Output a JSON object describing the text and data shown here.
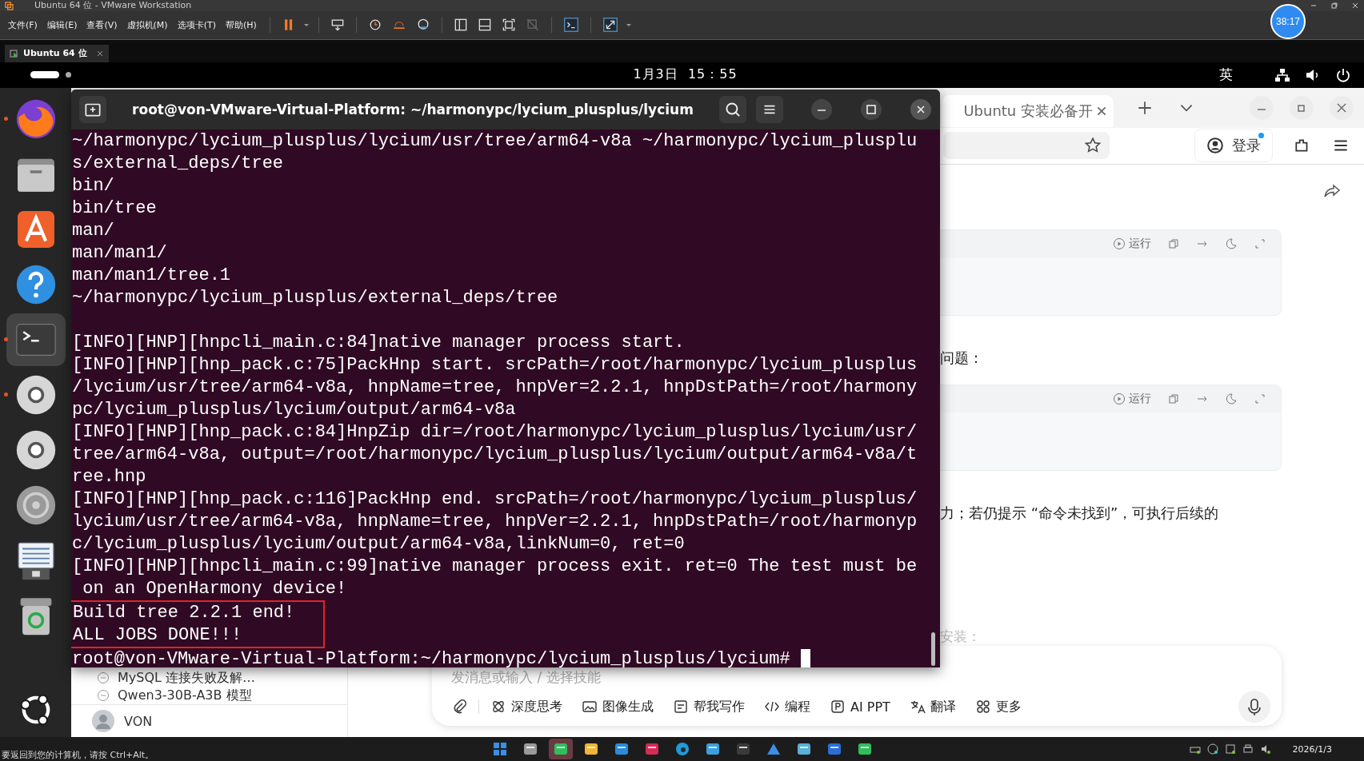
{
  "vmware": {
    "title": "Ubuntu 64 位 - VMware Workstation",
    "menu": [
      "文件(F)",
      "编辑(E)",
      "查看(V)",
      "虚拟机(M)",
      "选项卡(T)",
      "帮助(H)"
    ],
    "tabs": [
      {
        "label": "Ubuntu 64 位",
        "selected": true
      }
    ],
    "timer": "38:17",
    "status": "要返回到您的计算机，请按 Ctrl+Alt。"
  },
  "top_bar": {
    "date": "1月3日",
    "time": "15：55",
    "input_method": "英"
  },
  "dock": [
    {
      "kind": "firefox",
      "running": true,
      "selected": false
    },
    {
      "kind": "files",
      "running": false,
      "selected": false
    },
    {
      "kind": "store",
      "running": false,
      "selected": false
    },
    {
      "kind": "help",
      "running": false,
      "selected": false
    },
    {
      "kind": "terminal",
      "running": true,
      "selected": true
    },
    {
      "kind": "disc",
      "running": true,
      "selected": false
    },
    {
      "kind": "disc",
      "running": false,
      "selected": false
    },
    {
      "kind": "drive",
      "running": false,
      "selected": false
    },
    {
      "kind": "document",
      "running": false,
      "selected": false
    },
    {
      "kind": "trash",
      "running": false,
      "selected": false
    }
  ],
  "terminal": {
    "title": "root@von-VMware-Virtual-Platform: ~/harmonypc/lycium_plusplus/lycium",
    "lines": [
      {
        "kind": "text",
        "text": "~/harmonypc/lycium_plusplus/lycium/usr/tree/arm64-v8a ~/harmonypc/lycium_plusplu"
      },
      {
        "kind": "text",
        "text": "s/external_deps/tree"
      },
      {
        "kind": "text",
        "text": "bin/"
      },
      {
        "kind": "text",
        "text": "bin/tree"
      },
      {
        "kind": "text",
        "text": "man/"
      },
      {
        "kind": "text",
        "text": "man/man1/"
      },
      {
        "kind": "text",
        "text": "man/man1/tree.1"
      },
      {
        "kind": "text",
        "text": "~/harmonypc/lycium_plusplus/external_deps/tree"
      },
      {
        "kind": "blank"
      },
      {
        "kind": "text",
        "text": "[INFO][HNP][hnpcli_main.c:84]native manager process start."
      },
      {
        "kind": "text",
        "text": "[INFO][HNP][hnp_pack.c:75]PackHnp start. srcPath=/root/harmonypc/lycium_plusplus"
      },
      {
        "kind": "text",
        "text": "/lycium/usr/tree/arm64-v8a, hnpName=tree, hnpVer=2.2.1, hnpDstPath=/root/harmony"
      },
      {
        "kind": "text",
        "text": "pc/lycium_plusplus/lycium/output/arm64-v8a"
      },
      {
        "kind": "text",
        "text": "[INFO][HNP][hnp_pack.c:84]HnpZip dir=/root/harmonypc/lycium_plusplus/lycium/usr/"
      },
      {
        "kind": "text",
        "text": "tree/arm64-v8a, output=/root/harmonypc/lycium_plusplus/lycium/output/arm64-v8a/t"
      },
      {
        "kind": "text",
        "text": "ree.hnp"
      },
      {
        "kind": "text",
        "text": "[INFO][HNP][hnp_pack.c:116]PackHnp end. srcPath=/root/harmonypc/lycium_plusplus/"
      },
      {
        "kind": "text",
        "text": "lycium/usr/tree/arm64-v8a, hnpName=tree, hnpVer=2.2.1, hnpDstPath=/root/harmonyp"
      },
      {
        "kind": "text",
        "text": "c/lycium_plusplus/lycium/output/arm64-v8a,linkNum=0, ret=0"
      },
      {
        "kind": "text",
        "text": "[INFO][HNP][hnpcli_main.c:99]native manager process exit. ret=0 The test must be"
      },
      {
        "kind": "text",
        "text": " on an OpenHarmony device!"
      }
    ],
    "highlighted_lines": [
      "Build tree 2.2.1 end!",
      "ALL JOBS DONE!!!"
    ],
    "prompt": "root@von-VMware-Virtual-Platform:~/harmonypc/lycium_plusplus/lycium# "
  },
  "browser": {
    "tab": {
      "label": "Ubuntu 安装必备开",
      "selected": true
    },
    "login": "登录",
    "content": [
      {
        "kind": "code",
        "run_label": "运行"
      },
      {
        "kind": "text",
        "text": "问题："
      },
      {
        "kind": "code",
        "run_label": "运行"
      },
      {
        "kind": "text",
        "text": "力；若仍提示 “命令未找到”，可执行后续的"
      }
    ],
    "faded_text": "安装：",
    "sidebar": [
      {
        "label": "MySQL 连接失败及解…"
      },
      {
        "label": "Qwen3-30B-A3B 模型"
      }
    ],
    "user": "VON",
    "chat": {
      "placeholder": "发消息或输入 / 选择技能",
      "tools": [
        {
          "kind": "think",
          "label": "深度思考"
        },
        {
          "kind": "image",
          "label": "图像生成"
        },
        {
          "kind": "write",
          "label": "帮我写作"
        },
        {
          "kind": "code",
          "label": "编程"
        },
        {
          "kind": "ppt",
          "label": "AI PPT"
        },
        {
          "kind": "translate",
          "label": "翻译"
        },
        {
          "kind": "more",
          "label": "更多"
        }
      ]
    }
  },
  "taskbar": {
    "apps": [
      {
        "kind": "start",
        "selected": false
      },
      {
        "kind": "taskview",
        "selected": false
      },
      {
        "kind": "chat",
        "selected": true
      },
      {
        "kind": "folder",
        "selected": false
      },
      {
        "kind": "editor",
        "selected": false
      },
      {
        "kind": "ide",
        "selected": false
      },
      {
        "kind": "browser",
        "selected": false
      },
      {
        "kind": "vm",
        "selected": false
      },
      {
        "kind": "terminal",
        "selected": false
      },
      {
        "kind": "drive",
        "selected": false
      },
      {
        "kind": "app",
        "selected": false
      },
      {
        "kind": "bird",
        "selected": false
      },
      {
        "kind": "message",
        "selected": false
      }
    ],
    "date": "2026/1/3"
  }
}
